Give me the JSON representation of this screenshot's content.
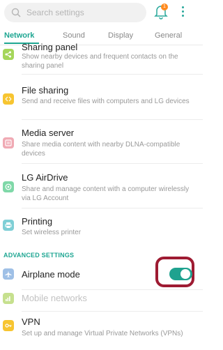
{
  "search": {
    "placeholder": "Search settings"
  },
  "notification": {
    "badge": "1"
  },
  "tabs": [
    {
      "label": "Network"
    },
    {
      "label": "Sound"
    },
    {
      "label": "Display"
    },
    {
      "label": "General"
    }
  ],
  "items": [
    {
      "title": "Sharing panel",
      "desc": "Show nearby devices and frequent contacts on the sharing panel",
      "color": "#a5d65a"
    },
    {
      "title": "File sharing",
      "desc": "Send and receive files with computers and LG devices",
      "color": "#f7c531"
    },
    {
      "title": "Media server",
      "desc": "Share media content with nearby DLNA-compatible devices",
      "color": "#f0aab4"
    },
    {
      "title": "LG AirDrive",
      "desc": "Share and manage content with a computer wirelessly via LG Account",
      "color": "#7fd8a8"
    },
    {
      "title": "Printing",
      "desc": "Set wireless printer",
      "color": "#7fcfd6"
    }
  ],
  "advanced": {
    "header": "ADVANCED SETTINGS",
    "airplane": {
      "title": "Airplane mode",
      "enabled": true,
      "color": "#9fc0e6"
    },
    "mobile": {
      "title": "Mobile networks",
      "color": "#c6e08e"
    },
    "vpn": {
      "title": "VPN",
      "desc": "Set up and manage Virtual Private Networks (VPNs)",
      "color": "#f7c531"
    }
  },
  "colors": {
    "accent": "#1ea692",
    "highlight": "#9e1b32"
  }
}
